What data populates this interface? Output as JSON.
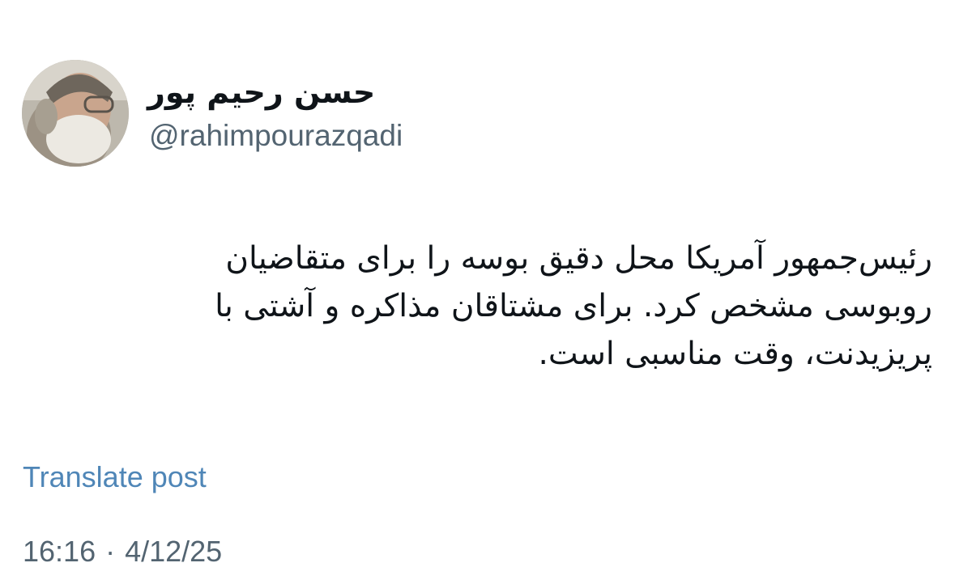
{
  "author": {
    "display_name": "حسن رحیم پور",
    "handle": "@rahimpourazqadi",
    "avatar_icon": "profile-photo"
  },
  "post": {
    "lines": [
      "رئیس‌جمهور آمریکا محل دقیق بوسه را برای متقاضیان",
      "روبوسی مشخص کرد. برای مشتاقان مذاکره و آشتی با",
      "پریزیدنت، وقت مناسبی است."
    ]
  },
  "translate_label": "Translate post",
  "meta": {
    "time": "16:16",
    "separator": "·",
    "date": "4/12/25"
  },
  "colors": {
    "text": "#0f1419",
    "secondary": "#536471",
    "link": "#4f86b7"
  }
}
